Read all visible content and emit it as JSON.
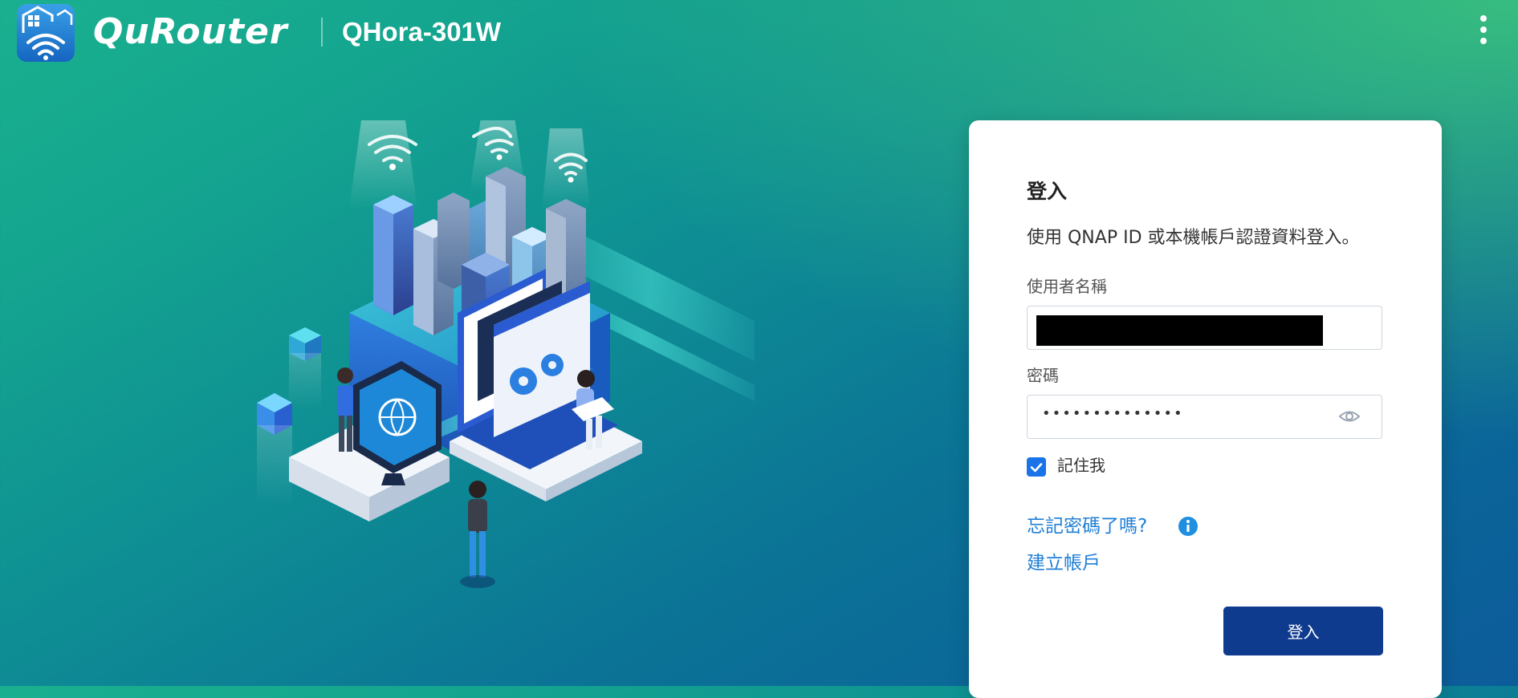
{
  "header": {
    "logo_text": "QuRouter",
    "device_name": "QHora-301W",
    "app_icon": "qurouter-wifi-house-icon",
    "menu_icon": "more-vertical-icon"
  },
  "login": {
    "title": "登入",
    "subtitle": "使用 QNAP ID 或本機帳戶認證資料登入。",
    "username_label": "使用者名稱",
    "username_value": "",
    "password_label": "密碼",
    "password_value": "••••••••••••••",
    "password_toggle_icon": "eye-icon",
    "remember_label": "記住我",
    "remember_checked": true,
    "forgot_link": "忘記密碼了嗎?",
    "forgot_info_icon": "info-icon",
    "create_link": "建立帳戶",
    "submit_label": "登入"
  },
  "colors": {
    "accent": "#1a73e8",
    "link": "#1f7fd6",
    "button": "#0f3b8f",
    "background_start": "#1ab08f",
    "background_end": "#0c5c9a"
  }
}
